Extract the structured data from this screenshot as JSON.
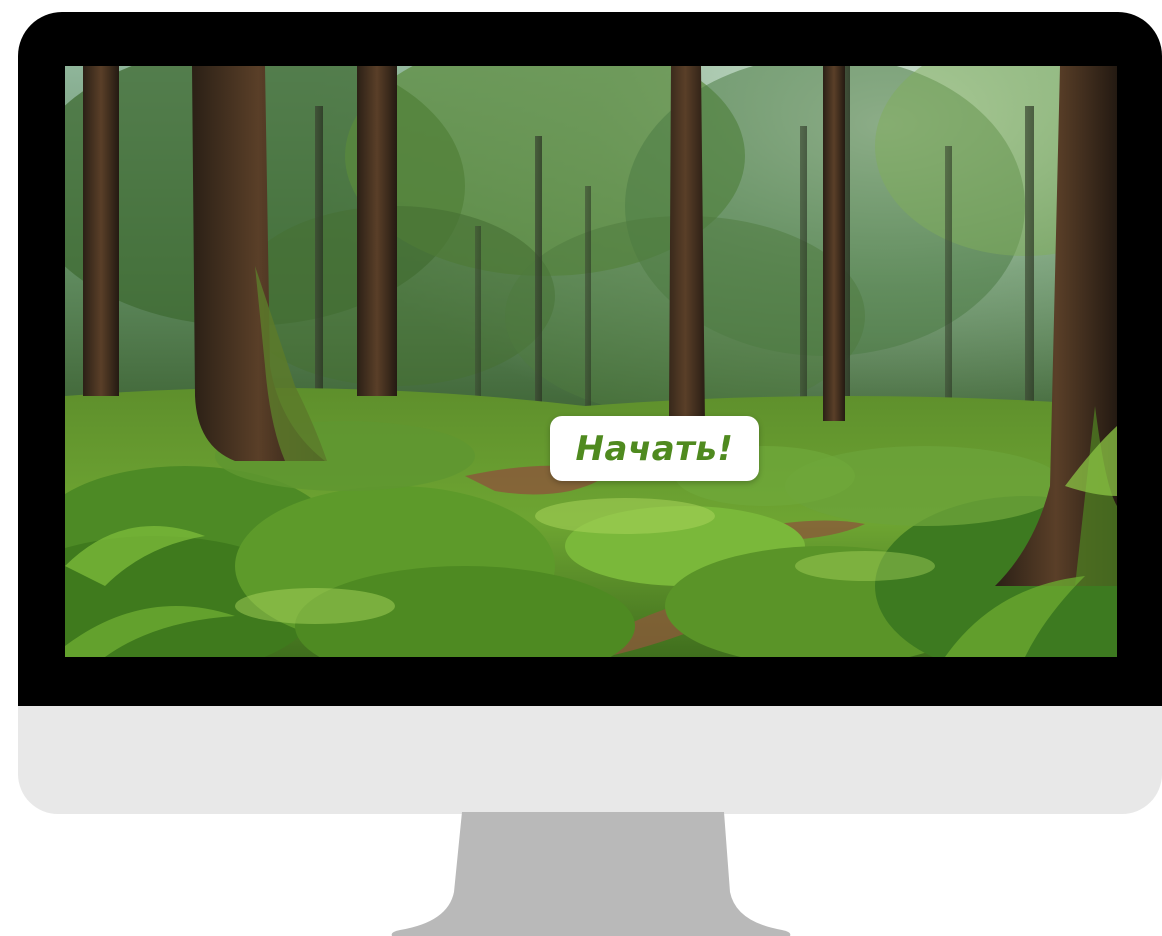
{
  "screen": {
    "scene": "forest-background",
    "start_button": {
      "label": "Начать!",
      "text_color": "#4f8a1f",
      "background": "#ffffff"
    }
  },
  "monitor": {
    "bezel_color": "#000000",
    "chin_color": "#e8e8e8",
    "stand_color": "#b9b9b9"
  }
}
